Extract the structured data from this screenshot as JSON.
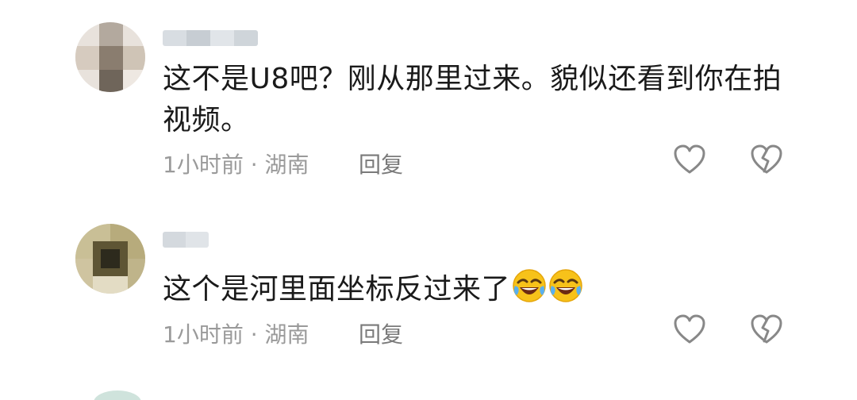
{
  "comments": [
    {
      "text": "这不是U8吧？刚从那里过来。貌似还看到你在拍视频。",
      "time": "1小时前",
      "location": "湖南",
      "separator": "·",
      "reply_label": "回复"
    },
    {
      "text": "这个是河里面坐标反过来了",
      "emojis": [
        "rofl-emoji",
        "rofl-emoji"
      ],
      "time": "1小时前",
      "location": "湖南",
      "separator": "·",
      "reply_label": "回复"
    }
  ],
  "icons": {
    "like": "heart-outline-icon",
    "dislike": "broken-heart-outline-icon"
  },
  "colors": {
    "meta_text": "#9a9a9a",
    "icon_stroke": "#888888",
    "body_text": "#1a1a1a"
  }
}
